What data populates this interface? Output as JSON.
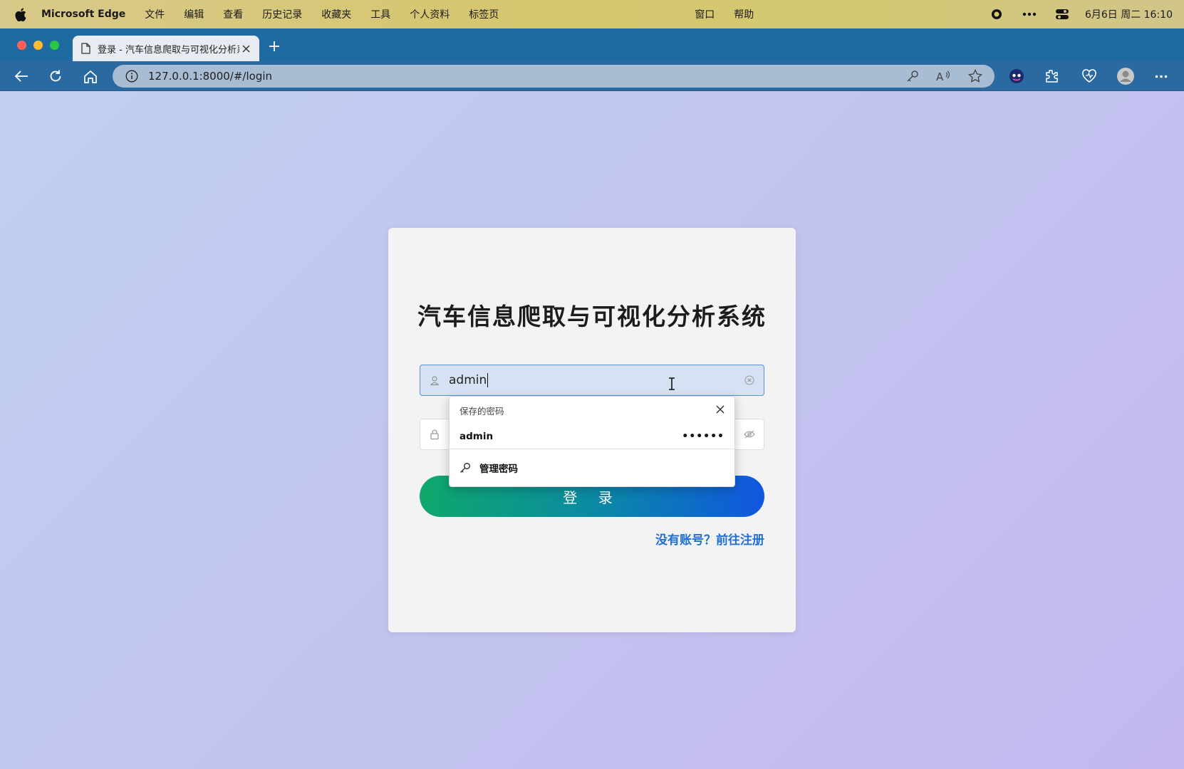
{
  "menubar": {
    "app_name": "Microsoft Edge",
    "items": [
      "文件",
      "编辑",
      "查看",
      "历史记录",
      "收藏夹",
      "工具",
      "个人资料",
      "标签页",
      "窗口",
      "帮助"
    ],
    "clock": "6月6日 周二 16:10"
  },
  "tab": {
    "title": "登录 - 汽车信息爬取与可视化分析系统"
  },
  "toolbar": {
    "url": "127.0.0.1:8000/#/login"
  },
  "login": {
    "title": "汽车信息爬取与可视化分析系统",
    "username_value": "admin",
    "password_value": "",
    "login_label": "登 录",
    "register_link": "没有账号？前往注册"
  },
  "autofill": {
    "header": "保存的密码",
    "saved_user": "admin",
    "saved_password_mask": "••••••",
    "manage_label": "管理密码"
  },
  "colors": {
    "tab_strip": "#1f6aa0",
    "toolbar": "#2a6aa1",
    "link": "#1f6fd6",
    "button_start": "#0fa86a",
    "button_end": "#1057e0"
  }
}
